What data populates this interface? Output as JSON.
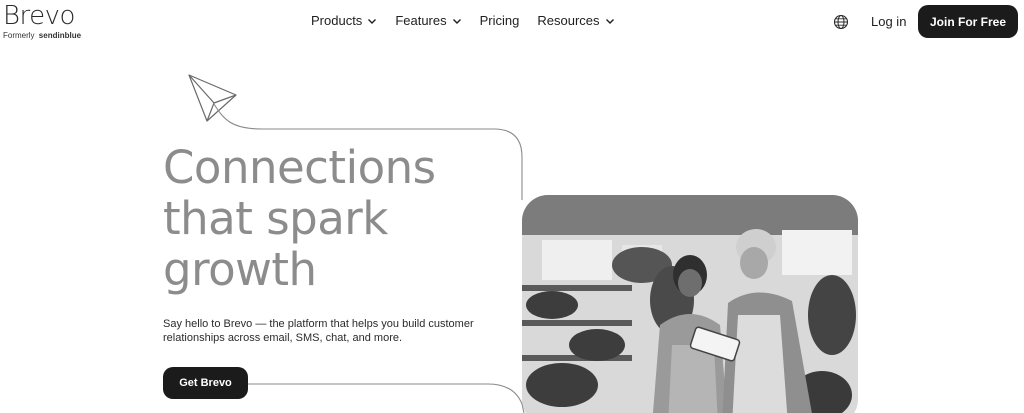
{
  "logo": {
    "word": "Brevo",
    "formerly": "Formerly",
    "former_brand": "sendinblue"
  },
  "nav": {
    "products": "Products",
    "features": "Features",
    "pricing": "Pricing",
    "resources": "Resources"
  },
  "header": {
    "language_icon": "globe-icon",
    "login": "Log in",
    "join": "Join For Free"
  },
  "hero": {
    "headline": [
      "Connections",
      "that spark",
      "growth"
    ],
    "subtext": "Say hello to Brevo — the platform that helps you build customer relationships across email, SMS, chat, and more.",
    "cta": "Get Brevo"
  },
  "colors": {
    "button_bg": "#1b1b1b",
    "headline": "#8c8c8c"
  }
}
